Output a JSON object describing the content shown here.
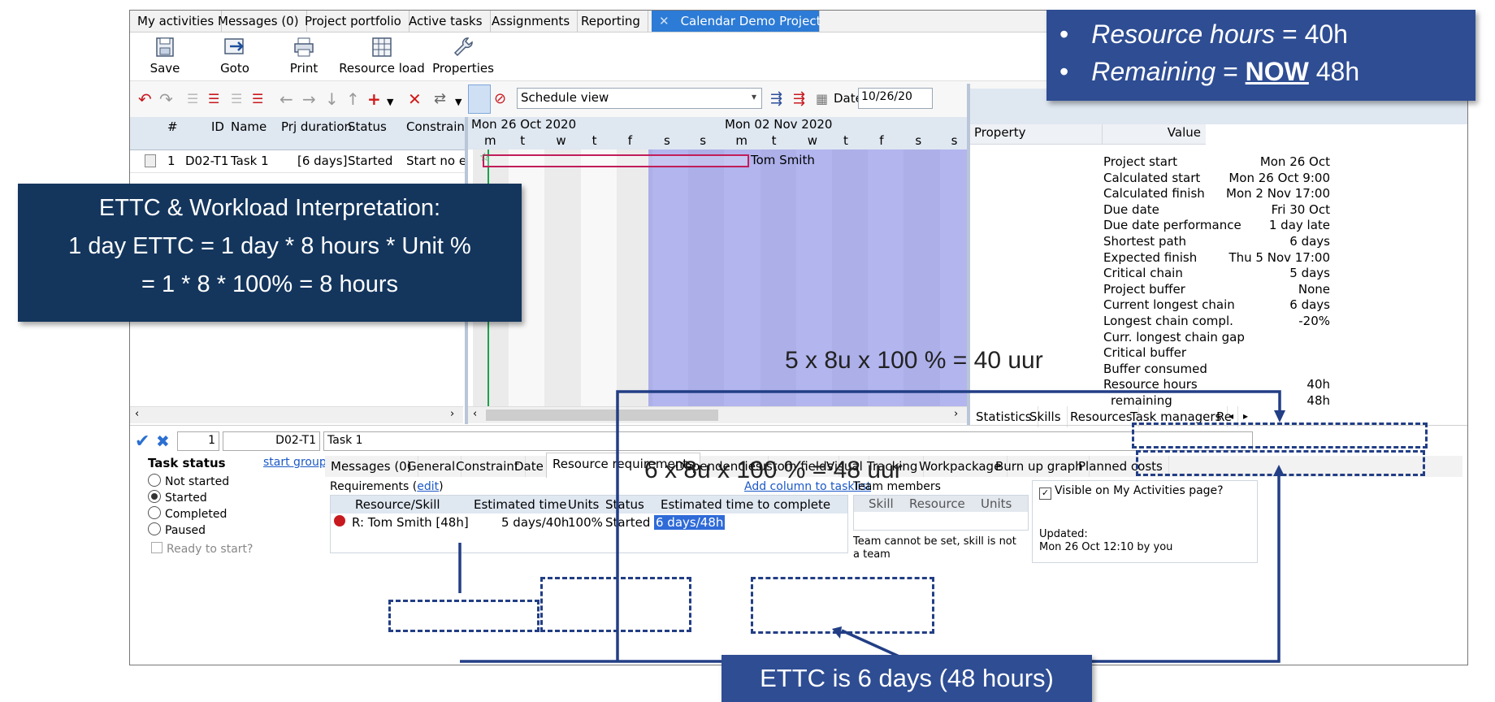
{
  "tabs": [
    {
      "label": "My activities"
    },
    {
      "label": "Messages (0)"
    },
    {
      "label": "Project portfolio"
    },
    {
      "label": "Active tasks"
    },
    {
      "label": "Assignments"
    },
    {
      "label": "Reporting"
    },
    {
      "label": "Calendar Demo Project",
      "close": "✕"
    }
  ],
  "ribbon": {
    "save": "Save",
    "goto": "Goto",
    "print": "Print",
    "resource_load": "Resource load",
    "properties": "Properties"
  },
  "toolbar": {
    "view_select": "Schedule view",
    "date_label": "Date",
    "date_value": "10/26/20"
  },
  "task_grid": {
    "headers": {
      "num": "#",
      "id": "ID",
      "name": "Name",
      "duration": "Prj duration",
      "status": "Status",
      "constraint": "Constraint"
    },
    "row": {
      "num": "1",
      "id": "D02-T1",
      "name": "Task 1",
      "duration": "[6 days]",
      "status": "Started",
      "constraint": "Start no ea"
    }
  },
  "gantt": {
    "week1": "Mon 26 Oct 2020",
    "week2": "Mon 02 Nov 2020",
    "days": [
      "m",
      "t",
      "w",
      "t",
      "f",
      "s",
      "s",
      "m",
      "t",
      "w",
      "t",
      "f",
      "s",
      "s"
    ],
    "bar_label": "Tom Smith"
  },
  "properties": {
    "header_property": "Property",
    "header_value": "Value",
    "rows": [
      {
        "name": "Project start",
        "value": "Mon 26 Oct"
      },
      {
        "name": "Calculated start",
        "value": "Mon 26 Oct 9:00"
      },
      {
        "name": "Calculated finish",
        "value": "Mon 2 Nov 17:00"
      },
      {
        "name": "Due date",
        "value": "Fri 30 Oct"
      },
      {
        "name": "Due date performance",
        "value": "1 day late"
      },
      {
        "name": "Shortest path",
        "value": "6 days"
      },
      {
        "name": "Expected finish",
        "value": "Thu 5 Nov 17:00"
      },
      {
        "name": "Critical chain",
        "value": "5 days"
      },
      {
        "name": "Project buffer",
        "value": "None"
      },
      {
        "name": "Current longest chain",
        "value": "6 days"
      },
      {
        "name": "Longest chain compl.",
        "value": "-20%"
      },
      {
        "name": "Curr. longest chain gap",
        "value": ""
      },
      {
        "name": "Critical buffer",
        "value": ""
      },
      {
        "name": "Buffer consumed",
        "value": ""
      },
      {
        "name": "Resource hours",
        "value": "40h"
      },
      {
        "name": "remaining",
        "value": "48h"
      }
    ],
    "tabs": [
      "Statistics",
      "Skills",
      "Resources",
      "Task managers",
      "Re"
    ]
  },
  "detail": {
    "num": "1",
    "id": "D02-T1",
    "name": "Task 1",
    "task_status_title": "Task status",
    "start_group": "start group",
    "statuses": [
      "Not started",
      "Started",
      "Completed",
      "Paused"
    ],
    "ready": "Ready to start?",
    "tabs": [
      "Messages (0)",
      "General",
      "Constraint",
      "Date",
      "Resource requirements",
      "Dependencies",
      "Custom fields",
      "Visual",
      "Tracking",
      "Workpackage",
      "Burn up graph",
      "Planned costs"
    ],
    "requirements_label": "Requirements (",
    "edit": "edit",
    "requirements_close": ")",
    "add_column": "Add column to tasklist",
    "table_headers": [
      "Resource/Skill",
      "Estimated time",
      "Units",
      "Status",
      "Estimated time to complete"
    ],
    "table_row": {
      "resource": "R: Tom Smith [48h]",
      "estimated": "5 days/40h",
      "units": "100%",
      "status": "Started",
      "ettc": "6 days/48h"
    },
    "team_members": "Team members",
    "team_headers": [
      "Skill",
      "Resource",
      "Units"
    ],
    "team_note": "Team cannot be set, skill is not a team",
    "visible_label": "Visible on My Activities page?",
    "updated_label": "Updated:",
    "updated_value": "Mon 26 Oct 12:10 by you"
  },
  "annotations": {
    "ettc_title": "ETTC & Workload Interpretation:",
    "ettc_line1": "1 day ETTC = 1 day * 8 hours  * Unit %",
    "ettc_line2": "= 1 * 8 * 100% = 8 hours",
    "resource_hours_label": "Resource hours",
    "resource_hours_eq": "= 40h",
    "remaining_label": "Remaining",
    "remaining_eq_pre": "=",
    "remaining_now": "NOW",
    "remaining_value": "48h",
    "formula_40": "5 x 8u x 100 % = 40 uur",
    "formula_48": "6 x 8u x 100 % = 48 uur",
    "ettc_bottom": "ETTC is 6 days (48 hours)"
  }
}
